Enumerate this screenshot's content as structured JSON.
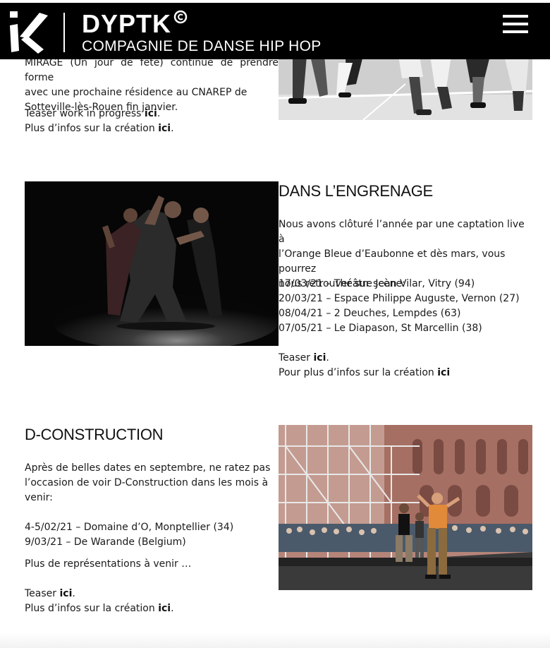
{
  "header": {
    "brand": "DYPTK",
    "tagline": "COMPAGNIE DE DANSE HIP HOP",
    "logo_icon": "k-logo-icon",
    "menu_icon": "hamburger-menu-icon"
  },
  "mirage": {
    "para_lines": [
      "MIRAGE (Un jour de fête) continue de prendre forme",
      "avec une prochaine résidence au CNAREP de",
      "Sotteville-lès-Rouen fin janvier."
    ],
    "teaser_prefix": "Teaser work in progress ",
    "teaser_link": "ici",
    "infos_prefix": "Plus d’infos sur la création ",
    "infos_link": "ici"
  },
  "engrenage": {
    "title": "DANS L’ENGRENAGE",
    "para_lines": [
      "Nous avons clôturé l’année par une captation live à",
      "l’Orange Bleue d’Eaubonne et dès mars, vous pourrez",
      "nous retrouver sur scène:"
    ],
    "dates": [
      "17/03/21 – Théâtre Jean Vilar, Vitry (94)",
      "20/03/21 – Espace Philippe Auguste, Vernon (27)",
      "08/04/21 – 2 Deuches, Lempdes (63)",
      "07/05/21 – Le Diapason, St Marcellin (38)"
    ],
    "teaser_prefix": "Teaser ",
    "teaser_link": "ici",
    "infos_prefix": "Pour plus d’infos sur la création ",
    "infos_link": "ici"
  },
  "dconstruction": {
    "title": "D-CONSTRUCTION",
    "para_lines": [
      "Après de belles dates en septembre, ne ratez pas",
      "l’occasion de voir D-Construction dans les mois à",
      "venir:"
    ],
    "dates": [
      "4-5/02/21 – Domaine d’O, Monptellier (34)",
      "9/03/21 – De Warande (Belgium)"
    ],
    "more": "Plus de représentations à venir …",
    "teaser_prefix": "Teaser ",
    "teaser_link": "ici",
    "infos_prefix": "Plus d’infos sur la création ",
    "infos_link": "ici"
  },
  "colors": {
    "header_bg": "#000000",
    "text": "#1a1a1a",
    "background": "#ffffff"
  }
}
